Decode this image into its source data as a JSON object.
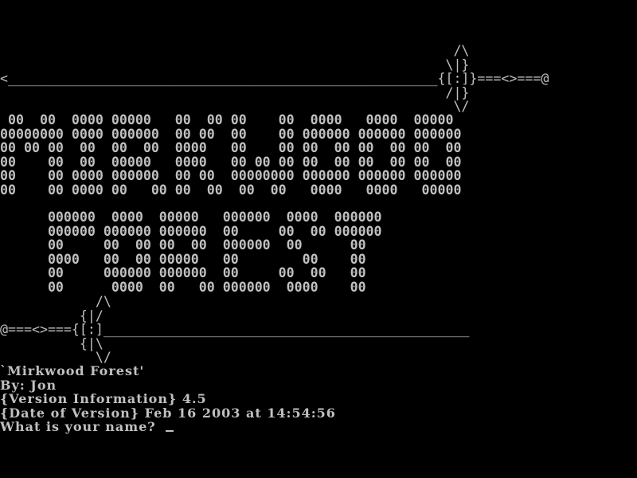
{
  "top_sword": "                                                         /\\\n                                                        \\|}\n<______________________________________________________{[:]}===<>===@\n                                                        /|}\n                                                         \\/",
  "banner": {
    "line1": [
      " 00  00  0000 00000   00  00 00    00  0000   0000  00000",
      "00000000 0000 000000  00 00  00    00 000000 000000 000000",
      "00 00 00  00  00  00  0000   00    00 00  00 00  00 00  00",
      "00    00  00  00000   0000   00 00 00 00  00 00  00 00  00",
      "00    00 0000 000000  00 00  00000000 000000 000000 000000",
      "00    00 0000 00   00 00  00  00  00   0000   0000   00000"
    ],
    "line2": [
      "      000000  0000  00000   000000  0000  000000",
      "      000000 000000 000000  00     00  00 000000",
      "      00     00  00 00  00  000000  00      00",
      "      0000   00  00 00000   00        00    00",
      "      00     000000 000000  00     00  00   00",
      "      00      0000  00   00 000000  0000    00"
    ]
  },
  "bottom_sword": "            /\\\n          {|/\n@===<>==={[:]______________________________________________\n          {|\\\n            \\/",
  "info": {
    "title": "`Mirkwood Forest'",
    "author": "By: Jon",
    "version": "{Version Information} 4.5",
    "date": "{Date of Version} Feb 16 2003 at 14:54:56",
    "prompt": "What is your name? ",
    "name_value": ""
  }
}
